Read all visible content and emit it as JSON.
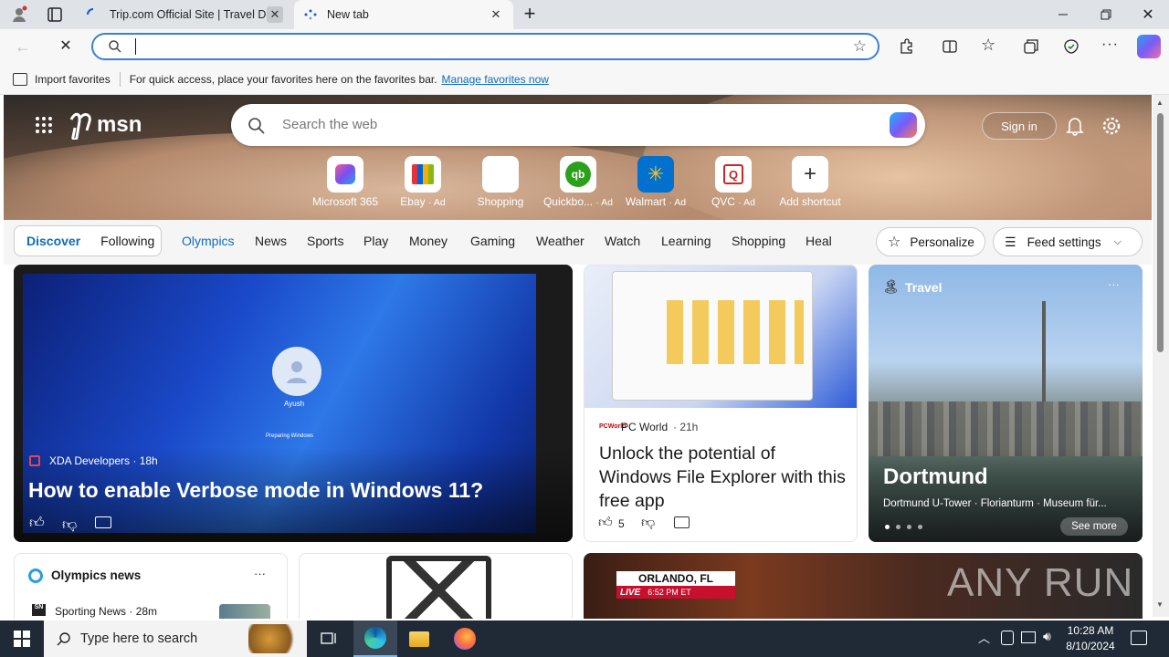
{
  "browser": {
    "tabs": [
      {
        "title": "Trip.com Official Site | Travel Deal"
      },
      {
        "title": "New tab"
      }
    ],
    "address_value": "",
    "favorites_bar": {
      "import_label": "Import favorites",
      "message": "For quick access, place your favorites here on the favorites bar.",
      "manage_link": "Manage favorites now"
    }
  },
  "msn": {
    "logo_text": "msn",
    "search_placeholder": "Search the web",
    "signin_label": "Sign in",
    "shortcuts": [
      {
        "label": "Microsoft 365",
        "ad": ""
      },
      {
        "label": "Ebay",
        "ad": "· Ad"
      },
      {
        "label": "Shopping",
        "ad": ""
      },
      {
        "label": "Quickbo...",
        "ad": "· Ad"
      },
      {
        "label": "Walmart",
        "ad": "· Ad"
      },
      {
        "label": "QVC",
        "ad": "· Ad"
      },
      {
        "label": "Add shortcut",
        "ad": ""
      }
    ],
    "feed_toggle": [
      "Discover",
      "Following"
    ],
    "nav": [
      "Olympics",
      "News",
      "Sports",
      "Play",
      "Money",
      "Gaming",
      "Weather",
      "Watch",
      "Learning",
      "Shopping",
      "Heal"
    ],
    "personalize_label": "Personalize",
    "feed_settings_label": "Feed settings",
    "cards": {
      "main": {
        "source": "XDA Developers · 18h",
        "title": "How to enable Verbose mode in Windows 11?",
        "screen_user": "Ayush",
        "screen_status": "Preparing Windows"
      },
      "pcworld": {
        "source": "PC World",
        "time": "· 21h",
        "title": "Unlock the potential of Windows File Explorer with this free app",
        "likes": "5"
      },
      "travel": {
        "tag": "Travel",
        "title": "Dortmund",
        "subtitle": "Dortmund U-Tower · Florianturm · Museum für...",
        "see_more": "See more"
      },
      "olympics": {
        "title": "Olympics news",
        "item_source": "Sporting News · 28m"
      },
      "fox": {
        "location": "ORLANDO, FL",
        "live": "LIVE",
        "time": "6:52 PM ET",
        "watermark": "ANY RUN"
      }
    }
  },
  "taskbar": {
    "search_placeholder": "Type here to search",
    "time": "10:28 AM",
    "date": "8/10/2024"
  },
  "colors": {
    "accent": "#0f6cbd",
    "taskbar": "#1f2a36",
    "address_border": "#3b7fd9"
  }
}
